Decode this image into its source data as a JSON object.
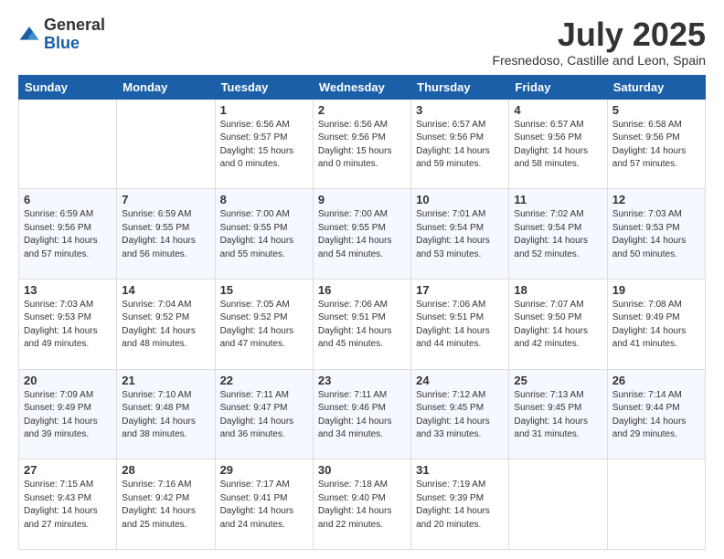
{
  "header": {
    "logo_general": "General",
    "logo_blue": "Blue",
    "month_year": "July 2025",
    "location": "Fresnedoso, Castille and Leon, Spain"
  },
  "weekdays": [
    "Sunday",
    "Monday",
    "Tuesday",
    "Wednesday",
    "Thursday",
    "Friday",
    "Saturday"
  ],
  "weeks": [
    [
      {
        "day": "",
        "info": ""
      },
      {
        "day": "",
        "info": ""
      },
      {
        "day": "1",
        "info": "Sunrise: 6:56 AM\nSunset: 9:57 PM\nDaylight: 15 hours\nand 0 minutes."
      },
      {
        "day": "2",
        "info": "Sunrise: 6:56 AM\nSunset: 9:56 PM\nDaylight: 15 hours\nand 0 minutes."
      },
      {
        "day": "3",
        "info": "Sunrise: 6:57 AM\nSunset: 9:56 PM\nDaylight: 14 hours\nand 59 minutes."
      },
      {
        "day": "4",
        "info": "Sunrise: 6:57 AM\nSunset: 9:56 PM\nDaylight: 14 hours\nand 58 minutes."
      },
      {
        "day": "5",
        "info": "Sunrise: 6:58 AM\nSunset: 9:56 PM\nDaylight: 14 hours\nand 57 minutes."
      }
    ],
    [
      {
        "day": "6",
        "info": "Sunrise: 6:59 AM\nSunset: 9:56 PM\nDaylight: 14 hours\nand 57 minutes."
      },
      {
        "day": "7",
        "info": "Sunrise: 6:59 AM\nSunset: 9:55 PM\nDaylight: 14 hours\nand 56 minutes."
      },
      {
        "day": "8",
        "info": "Sunrise: 7:00 AM\nSunset: 9:55 PM\nDaylight: 14 hours\nand 55 minutes."
      },
      {
        "day": "9",
        "info": "Sunrise: 7:00 AM\nSunset: 9:55 PM\nDaylight: 14 hours\nand 54 minutes."
      },
      {
        "day": "10",
        "info": "Sunrise: 7:01 AM\nSunset: 9:54 PM\nDaylight: 14 hours\nand 53 minutes."
      },
      {
        "day": "11",
        "info": "Sunrise: 7:02 AM\nSunset: 9:54 PM\nDaylight: 14 hours\nand 52 minutes."
      },
      {
        "day": "12",
        "info": "Sunrise: 7:03 AM\nSunset: 9:53 PM\nDaylight: 14 hours\nand 50 minutes."
      }
    ],
    [
      {
        "day": "13",
        "info": "Sunrise: 7:03 AM\nSunset: 9:53 PM\nDaylight: 14 hours\nand 49 minutes."
      },
      {
        "day": "14",
        "info": "Sunrise: 7:04 AM\nSunset: 9:52 PM\nDaylight: 14 hours\nand 48 minutes."
      },
      {
        "day": "15",
        "info": "Sunrise: 7:05 AM\nSunset: 9:52 PM\nDaylight: 14 hours\nand 47 minutes."
      },
      {
        "day": "16",
        "info": "Sunrise: 7:06 AM\nSunset: 9:51 PM\nDaylight: 14 hours\nand 45 minutes."
      },
      {
        "day": "17",
        "info": "Sunrise: 7:06 AM\nSunset: 9:51 PM\nDaylight: 14 hours\nand 44 minutes."
      },
      {
        "day": "18",
        "info": "Sunrise: 7:07 AM\nSunset: 9:50 PM\nDaylight: 14 hours\nand 42 minutes."
      },
      {
        "day": "19",
        "info": "Sunrise: 7:08 AM\nSunset: 9:49 PM\nDaylight: 14 hours\nand 41 minutes."
      }
    ],
    [
      {
        "day": "20",
        "info": "Sunrise: 7:09 AM\nSunset: 9:49 PM\nDaylight: 14 hours\nand 39 minutes."
      },
      {
        "day": "21",
        "info": "Sunrise: 7:10 AM\nSunset: 9:48 PM\nDaylight: 14 hours\nand 38 minutes."
      },
      {
        "day": "22",
        "info": "Sunrise: 7:11 AM\nSunset: 9:47 PM\nDaylight: 14 hours\nand 36 minutes."
      },
      {
        "day": "23",
        "info": "Sunrise: 7:11 AM\nSunset: 9:46 PM\nDaylight: 14 hours\nand 34 minutes."
      },
      {
        "day": "24",
        "info": "Sunrise: 7:12 AM\nSunset: 9:45 PM\nDaylight: 14 hours\nand 33 minutes."
      },
      {
        "day": "25",
        "info": "Sunrise: 7:13 AM\nSunset: 9:45 PM\nDaylight: 14 hours\nand 31 minutes."
      },
      {
        "day": "26",
        "info": "Sunrise: 7:14 AM\nSunset: 9:44 PM\nDaylight: 14 hours\nand 29 minutes."
      }
    ],
    [
      {
        "day": "27",
        "info": "Sunrise: 7:15 AM\nSunset: 9:43 PM\nDaylight: 14 hours\nand 27 minutes."
      },
      {
        "day": "28",
        "info": "Sunrise: 7:16 AM\nSunset: 9:42 PM\nDaylight: 14 hours\nand 25 minutes."
      },
      {
        "day": "29",
        "info": "Sunrise: 7:17 AM\nSunset: 9:41 PM\nDaylight: 14 hours\nand 24 minutes."
      },
      {
        "day": "30",
        "info": "Sunrise: 7:18 AM\nSunset: 9:40 PM\nDaylight: 14 hours\nand 22 minutes."
      },
      {
        "day": "31",
        "info": "Sunrise: 7:19 AM\nSunset: 9:39 PM\nDaylight: 14 hours\nand 20 minutes."
      },
      {
        "day": "",
        "info": ""
      },
      {
        "day": "",
        "info": ""
      }
    ]
  ]
}
